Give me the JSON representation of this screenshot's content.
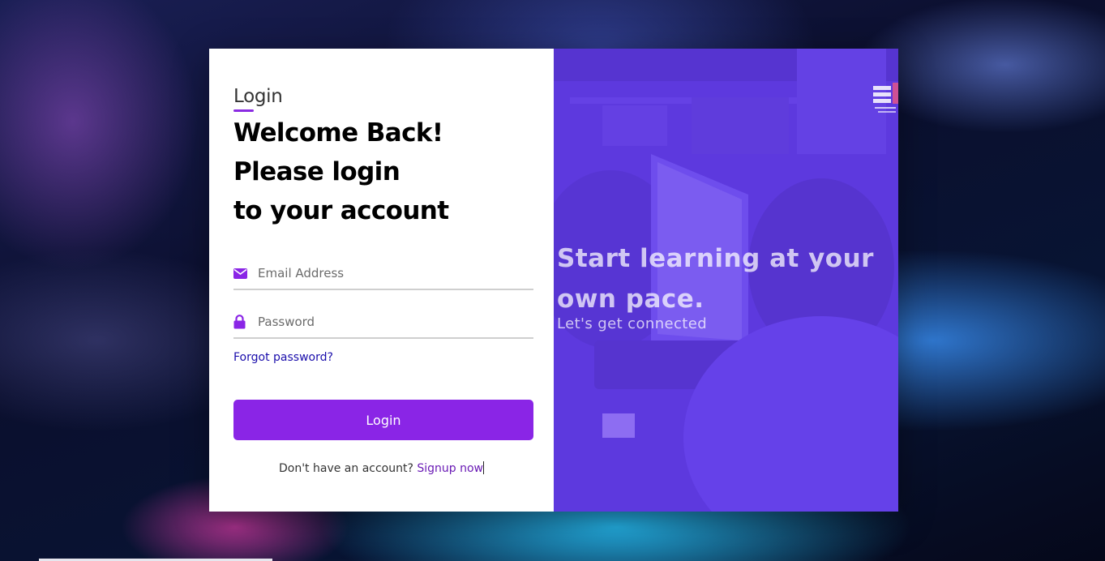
{
  "login_panel": {
    "tab_label": "Login",
    "heading_lines": [
      "Welcome Back!",
      "Please login",
      "to your account"
    ],
    "email": {
      "placeholder": "Email Address",
      "value": "",
      "icon": "envelope-icon"
    },
    "password": {
      "placeholder": "Password",
      "value": "",
      "icon": "lock-icon"
    },
    "forgot_password": "Forgot password?",
    "login_button": "Login",
    "signup_prompt": "Don't have an account?",
    "signup_link": "Signup now"
  },
  "hero_panel": {
    "title": "Start learning at your own pace.",
    "subtitle": "Let's get connected"
  },
  "colors": {
    "accent": "#8a25e6",
    "link": "#1a0dab",
    "overlay": "#6e3cf0"
  }
}
